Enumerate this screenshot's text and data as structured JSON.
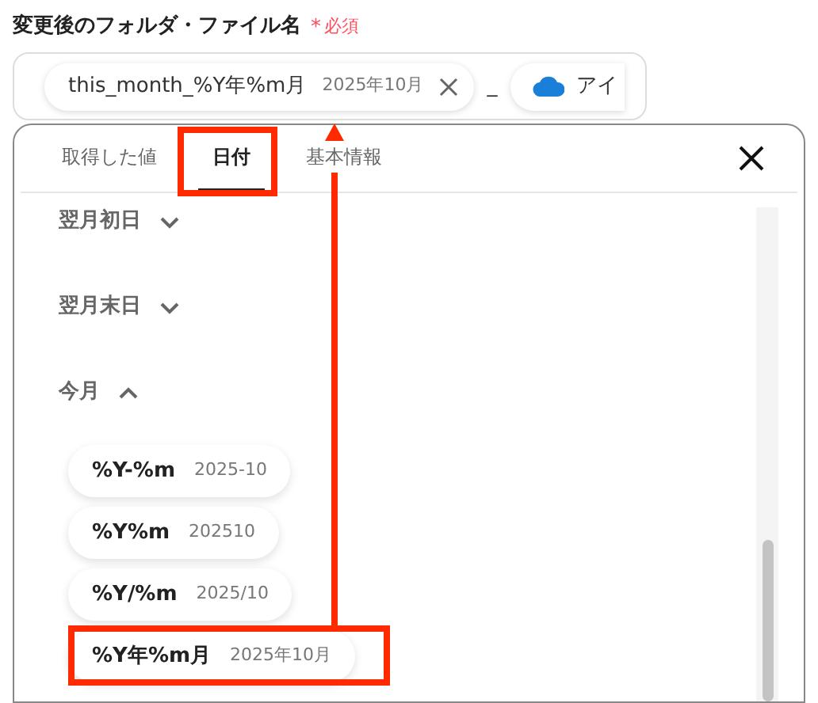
{
  "field": {
    "label": "変更後のフォルダ・ファイル名",
    "required_mark": "*",
    "required_text": "必須",
    "tokens": [
      {
        "kind": "format",
        "text": "this_month_%Y年%m月",
        "preview": "2025年10月"
      },
      {
        "kind": "separator",
        "text": "_"
      },
      {
        "kind": "source",
        "text": "アイ"
      }
    ]
  },
  "picker": {
    "tabs": [
      {
        "label": "取得した値",
        "selected": false
      },
      {
        "label": "日付",
        "selected": true
      },
      {
        "label": "基本情報",
        "selected": false
      }
    ],
    "sections": [
      {
        "label": "翌月初日",
        "expanded": false
      },
      {
        "label": "翌月末日",
        "expanded": false
      },
      {
        "label": "今月",
        "expanded": true,
        "options": [
          {
            "format": "%Y-%m",
            "preview": "2025-10"
          },
          {
            "format": "%Y%m",
            "preview": "202510"
          },
          {
            "format": "%Y/%m",
            "preview": "2025/10"
          },
          {
            "format": "%Y年%m月",
            "preview": "2025年10月"
          }
        ]
      }
    ]
  }
}
